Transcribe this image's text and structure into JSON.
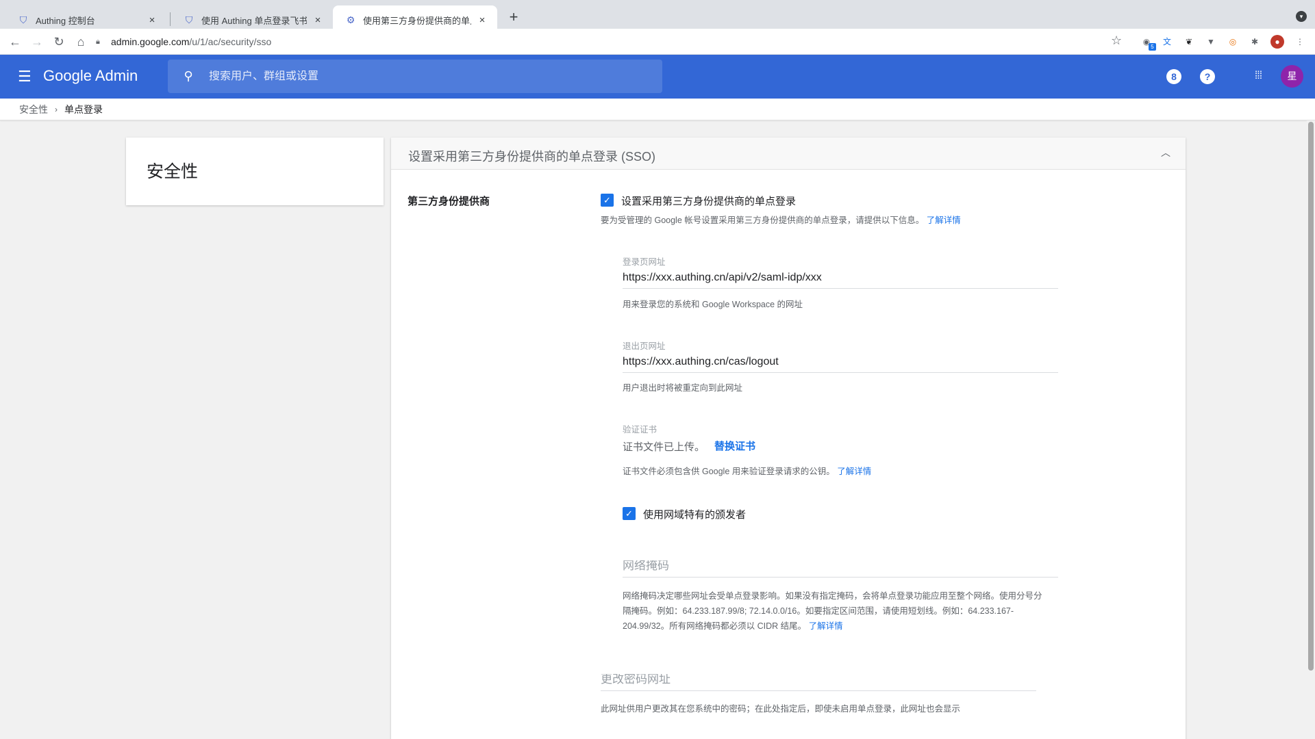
{
  "browser": {
    "tabs": [
      {
        "label": "Authing 控制台",
        "close": "×"
      },
      {
        "label": "使用 Authing 单点登录飞书 | Authing 文档",
        "close": "×"
      },
      {
        "label": "使用第三方身份提供商的单点登录",
        "close": "×"
      }
    ],
    "new_tab": "+",
    "url_host": "admin.google.com",
    "url_path": "/u/1/ac/security/sso",
    "extension_badge": "5"
  },
  "header": {
    "brand_google": "Google",
    "brand_admin": "Admin",
    "search_placeholder": "搜索用户、群组或设置",
    "account_avatar": "星",
    "notification_count": "8",
    "help": "?"
  },
  "breadcrumb": {
    "parent": "安全性",
    "current": "单点登录"
  },
  "side_card": {
    "title": "安全性"
  },
  "main": {
    "title": "设置采用第三方身份提供商的单点登录 (SSO)",
    "section_label": "第三方身份提供商",
    "enable_checkbox": {
      "label": "设置采用第三方身份提供商的单点登录",
      "checked": true
    },
    "enable_hint": "要为受管理的 Google 帐号设置采用第三方身份提供商的单点登录，请提供以下信息。",
    "learn_more": "了解详情",
    "signin_url": {
      "label": "登录页网址",
      "value": "https://xxx.authing.cn/api/v2/saml-idp/xxx",
      "hint": "用来登录您的系统和 Google Workspace 的网址"
    },
    "signout_url": {
      "label": "退出页网址",
      "value": "https://xxx.authing.cn/cas/logout",
      "hint": "用户退出时将被重定向到此网址"
    },
    "certificate": {
      "label": "验证证书",
      "status": "证书文件已上传。",
      "replace": "替换证书",
      "hint": "证书文件必须包含供 Google 用来验证登录请求的公钥。"
    },
    "domain_issuer": {
      "label": "使用网域特有的颁发者",
      "checked": true
    },
    "netmask": {
      "placeholder": "网络掩码",
      "hint_line1": "网络掩码决定哪些网址会受单点登录影响。如果没有指定掩码，会将单点登录功能应用至整个网络。使用分号分",
      "hint_line2": "隔掩码。例如：64.233.187.99/8; 72.14.0.0/16。如要指定区间范围，请使用短划线。例如：64.233.167-",
      "hint_line3": "204.99/32。所有网络掩码都必须以 CIDR 结尾。"
    },
    "change_password": {
      "placeholder": "更改密码网址",
      "hint": "此网址供用户更改其在您系统中的密码；在此处指定后，即使未启用单点登录，此网址也会显示"
    }
  }
}
